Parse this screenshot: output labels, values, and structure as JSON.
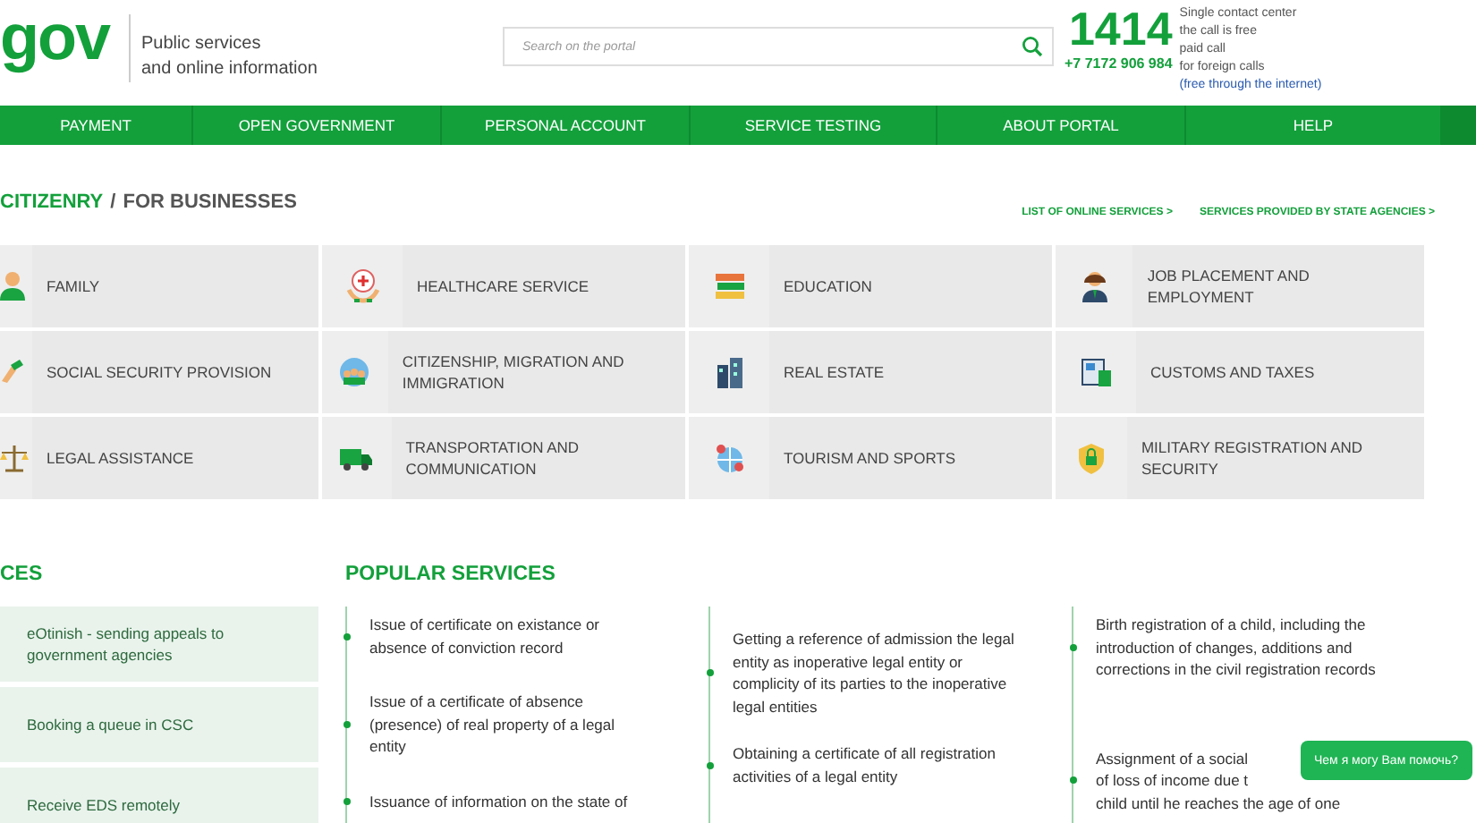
{
  "header": {
    "logo": "gov",
    "tagline": [
      "Public services",
      "and online information"
    ],
    "search": {
      "placeholder": "Search on the portal"
    },
    "hotline": {
      "short_number": "1414",
      "phone": "+7 7172 906 984",
      "info": [
        "Single contact center",
        "the call is free",
        "paid call"
      ],
      "foreign_text": "for foreign calls",
      "foreign_link": "(free through the internet)"
    }
  },
  "nav": [
    {
      "label": "PAYMENT"
    },
    {
      "label": "OPEN GOVERNMENT"
    },
    {
      "label": "PERSONAL ACCOUNT"
    },
    {
      "label": "SERVICE TESTING"
    },
    {
      "label": "ABOUT PORTAL"
    },
    {
      "label": "HELP"
    }
  ],
  "audience_tabs": [
    {
      "label": "CITIZENRY",
      "selected": true
    },
    {
      "label": "FOR BUSINESSES",
      "selected": false
    }
  ],
  "tab_separator": "/",
  "links": [
    "LIST OF ONLINE SERVICES >",
    "SERVICES PROVIDED BY STATE AGENCIES >"
  ],
  "categories": [
    {
      "label": "FAMILY"
    },
    {
      "label": "HEALTHCARE SERVICE"
    },
    {
      "label": "EDUCATION"
    },
    {
      "label": "JOB PLACEMENT AND EMPLOYMENT"
    },
    {
      "label": "SOCIAL SECURITY PROVISION"
    },
    {
      "label": "CITIZENSHIP, MIGRATION AND IMMIGRATION"
    },
    {
      "label": "REAL ESTATE"
    },
    {
      "label": "CUSTOMS AND TAXES"
    },
    {
      "label": "LEGAL ASSISTANCE"
    },
    {
      "label": "TRANSPORTATION AND COMMUNICATION"
    },
    {
      "label": "TOURISM AND SPORTS"
    },
    {
      "label": "MILITARY REGISTRATION AND SECURITY"
    }
  ],
  "eservices": {
    "title": "CES",
    "items": [
      "eOtinish - sending appeals to government agencies",
      "Booking a queue in CSC",
      "Receive EDS remotely"
    ]
  },
  "popular": {
    "title": "POPULAR SERVICES",
    "columns": [
      {
        "items": [
          {
            "lines": [
              "Issue of certificate on existance or absence of conviction record"
            ]
          },
          {
            "lines": [
              "Issue of a certificate of absence (presence) of real property of a legal entity"
            ]
          },
          {
            "lines": [
              "Issuance of information on the state of"
            ]
          }
        ]
      },
      {
        "items": [
          {
            "lines": [
              "Getting a reference of admission the legal entity as inoperative legal entity or complicity of its parties to the inoperative legal entities"
            ]
          },
          {
            "lines": [
              "Obtaining a certificate of all registration activities of a legal entity"
            ]
          }
        ]
      },
      {
        "items": [
          {
            "lines": [
              "Birth registration of a child, including the introduction of changes, additions and corrections in the civil registration records"
            ]
          },
          {
            "lines": [
              "Assignment of a social",
              "of loss of income due t",
              "child until he reaches the age of one"
            ]
          }
        ]
      }
    ]
  },
  "chat_button": "Чем я могу Вам помочь?"
}
